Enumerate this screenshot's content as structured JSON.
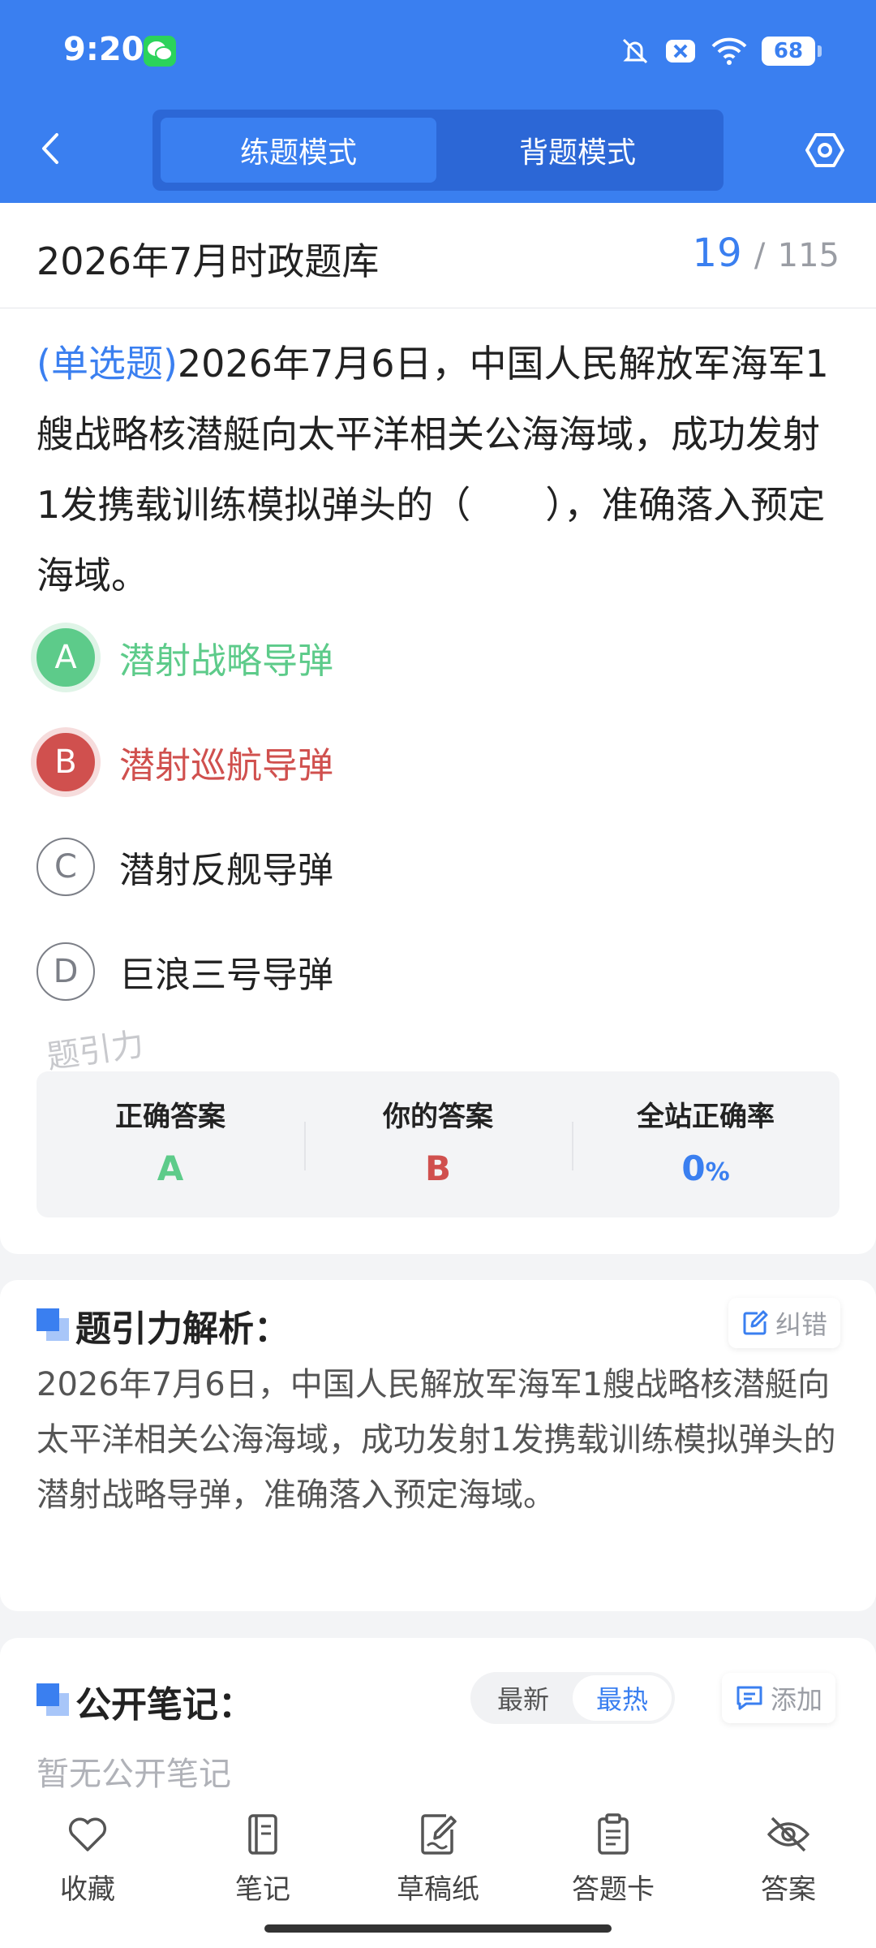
{
  "status_bar": {
    "time": "9:20",
    "battery": "68"
  },
  "header": {
    "tabs": [
      {
        "label": "练题模式",
        "active": true
      },
      {
        "label": "背题模式",
        "active": false
      }
    ]
  },
  "question": {
    "bank_title": "2026年7月时政题库",
    "current": "19",
    "separator": "/",
    "total": "115",
    "type_label": "(单选题)",
    "text": "2026年7月6日，中国人民解放军海军1艘战略核潜艇向太平洋相关公海海域，成功发射1发携载训练模拟弹头的（　　），准确落入预定海域。",
    "options": [
      {
        "letter": "A",
        "text": "潜射战略导弹",
        "state": "correct"
      },
      {
        "letter": "B",
        "text": "潜射巡航导弹",
        "state": "wrong"
      },
      {
        "letter": "C",
        "text": "潜射反舰导弹",
        "state": "normal"
      },
      {
        "letter": "D",
        "text": "巨浪三号导弹",
        "state": "normal"
      }
    ],
    "watermark": "题引力"
  },
  "result": {
    "correct_label": "正确答案",
    "correct_value": "A",
    "yours_label": "你的答案",
    "yours_value": "B",
    "rate_label": "全站正确率",
    "rate_value": "0",
    "rate_unit": "%"
  },
  "analysis": {
    "title": "题引力解析：",
    "report_label": "纠错",
    "text": "2026年7月6日，中国人民解放军海军1艘战略核潜艇向太平洋相关公海海域，成功发射1发携载训练模拟弹头的潜射战略导弹，准确落入预定海域。"
  },
  "notes": {
    "title": "公开笔记：",
    "sort_latest": "最新",
    "sort_hot": "最热",
    "add_label": "添加",
    "empty_text": "暂无公开笔记"
  },
  "bottom_nav": [
    {
      "label": "收藏",
      "icon": "heart-icon"
    },
    {
      "label": "笔记",
      "icon": "notebook-icon"
    },
    {
      "label": "草稿纸",
      "icon": "draft-icon"
    },
    {
      "label": "答题卡",
      "icon": "clipboard-icon"
    },
    {
      "label": "答案",
      "icon": "eye-off-icon"
    }
  ],
  "colors": {
    "primary": "#3a7ff0",
    "correct": "#5dcb8a",
    "wrong": "#d0504e"
  }
}
